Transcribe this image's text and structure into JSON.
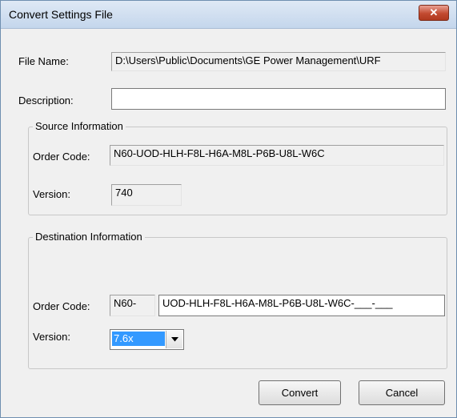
{
  "window": {
    "title": "Convert Settings File",
    "close_icon": "close-icon"
  },
  "file": {
    "name_label": "File Name:",
    "name_value": "D:\\Users\\Public\\Documents\\GE Power Management\\URF",
    "description_label": "Description:",
    "description_value": ""
  },
  "source": {
    "title": "Source Information",
    "order_code_label": "Order Code:",
    "order_code_value": "N60-UOD-HLH-F8L-H6A-M8L-P6B-U8L-W6C",
    "version_label": "Version:",
    "version_value": "740"
  },
  "destination": {
    "title": "Destination Information",
    "order_code_label": "Order Code:",
    "order_code_prefix": "N60-",
    "order_code_value": "UOD-HLH-F8L-H6A-M8L-P6B-U8L-W6C-___-___",
    "version_label": "Version:",
    "version_selected": "7.6x"
  },
  "buttons": {
    "convert": "Convert",
    "cancel": "Cancel"
  }
}
